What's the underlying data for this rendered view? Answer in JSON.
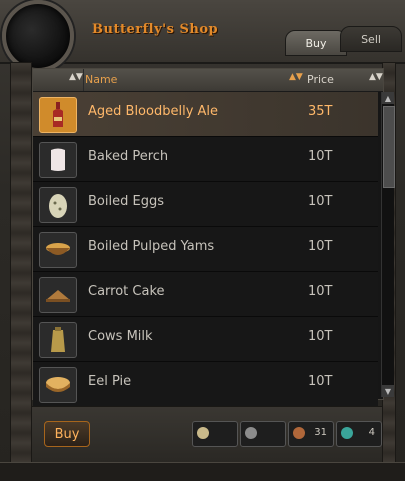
{
  "window": {
    "title": "Butterfly's Shop"
  },
  "tabs": [
    {
      "label": "Buy",
      "active": true
    },
    {
      "label": "Sell",
      "active": false
    }
  ],
  "table": {
    "columns": {
      "name": "Name",
      "price": "Price"
    },
    "rows": [
      {
        "icon": "wine-bottle-icon",
        "name": "Aged Bloodbelly Ale",
        "price": "35T",
        "selected": true
      },
      {
        "icon": "fish-fillet-icon",
        "name": "Baked Perch",
        "price": "10T",
        "selected": false
      },
      {
        "icon": "egg-icon",
        "name": "Boiled Eggs",
        "price": "10T",
        "selected": false
      },
      {
        "icon": "bowl-icon",
        "name": "Boiled Pulped Yams",
        "price": "10T",
        "selected": false
      },
      {
        "icon": "cake-icon",
        "name": "Carrot Cake",
        "price": "10T",
        "selected": false
      },
      {
        "icon": "milk-jug-icon",
        "name": "Cows Milk",
        "price": "10T",
        "selected": false
      },
      {
        "icon": "pie-icon",
        "name": "Eel Pie",
        "price": "10T",
        "selected": false
      }
    ]
  },
  "footer": {
    "buy_label": "Buy",
    "currency": [
      {
        "name": "coin-gold",
        "value": "",
        "color": "#c9b98a"
      },
      {
        "name": "coin-silver",
        "value": "",
        "color": "#8c8c8c"
      },
      {
        "name": "coin-copper",
        "value": "31",
        "color": "#b0673a"
      },
      {
        "name": "gem-teal",
        "value": "4",
        "color": "#3aa59a"
      }
    ]
  },
  "colors": {
    "accent": "#e38a2a",
    "selected_row_text": "#ffb86a",
    "text": "#c7c3bb"
  }
}
